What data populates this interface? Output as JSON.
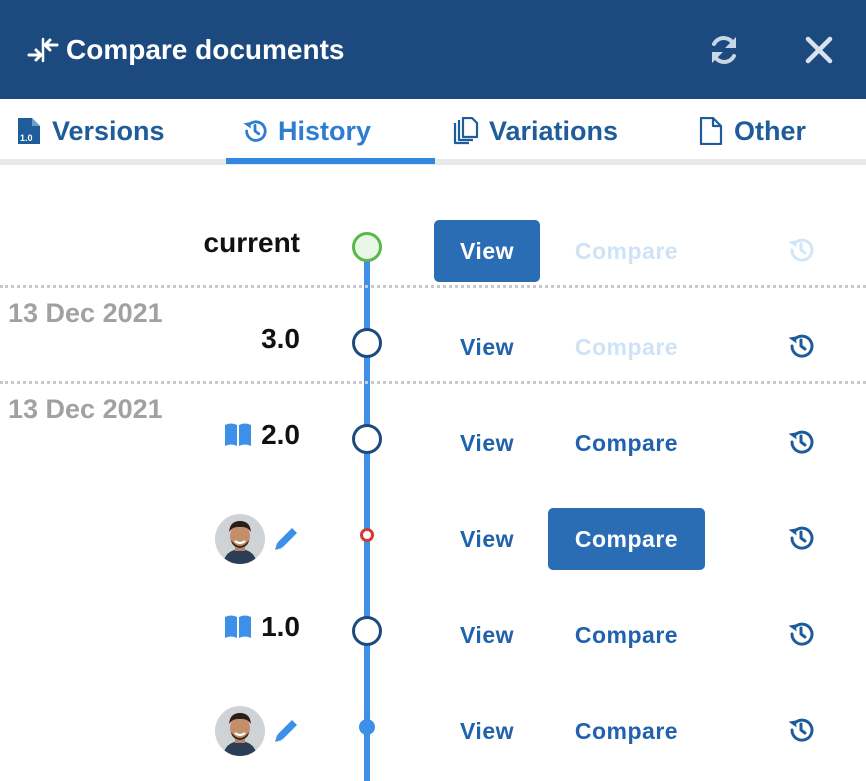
{
  "header": {
    "title": "Compare documents",
    "icons": {
      "title": "compare-arrows-icon",
      "refresh": "refresh-icon",
      "close": "close-icon"
    },
    "colors": {
      "background": "#1d4a7e",
      "text": "#ffffff"
    }
  },
  "tabs": [
    {
      "label": "Versions",
      "icon": "version-file-icon",
      "active": false
    },
    {
      "label": "History",
      "icon": "history-icon",
      "active": true
    },
    {
      "label": "Variations",
      "icon": "copies-icon",
      "active": false
    },
    {
      "label": "Other",
      "icon": "file-icon",
      "active": false
    }
  ],
  "accent_color": "#3387e0",
  "timeline": {
    "rows": [
      {
        "label": "current",
        "node": "current",
        "view": {
          "label": "View",
          "style": "primary"
        },
        "compare": {
          "label": "Compare",
          "style": "disabled"
        },
        "restore_disabled": true
      },
      {
        "date": "13 Dec 2021",
        "label": "3.0",
        "node": "major",
        "view": {
          "label": "View",
          "style": "link"
        },
        "compare": {
          "label": "Compare",
          "style": "disabled"
        },
        "restore_disabled": false
      },
      {
        "date": "13 Dec 2021",
        "label": "2.0",
        "published_icon": "open-book-icon",
        "node": "major",
        "view": {
          "label": "View",
          "style": "link"
        },
        "compare": {
          "label": "Compare",
          "style": "link"
        },
        "restore_disabled": false
      },
      {
        "avatar": "user-avatar",
        "edit_icon": "pencil-icon",
        "node": "selected-minor",
        "view": {
          "label": "View",
          "style": "link"
        },
        "compare": {
          "label": "Compare",
          "style": "primary"
        },
        "restore_disabled": false
      },
      {
        "label": "1.0",
        "published_icon": "open-book-icon",
        "node": "major",
        "view": {
          "label": "View",
          "style": "link"
        },
        "compare": {
          "label": "Compare",
          "style": "link"
        },
        "restore_disabled": false
      },
      {
        "avatar": "user-avatar",
        "edit_icon": "pencil-icon",
        "node": "minor",
        "view": {
          "label": "View",
          "style": "link"
        },
        "compare": {
          "label": "Compare",
          "style": "link"
        },
        "restore_disabled": false
      }
    ]
  }
}
